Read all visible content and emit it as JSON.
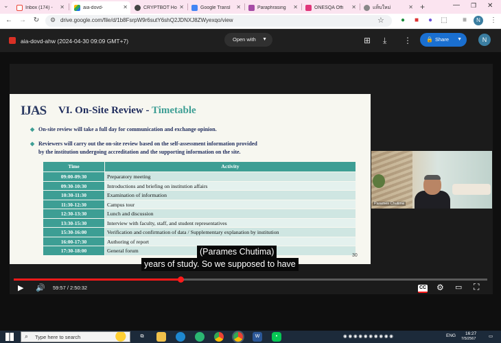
{
  "tabs": [
    {
      "label": "Inbox (174) -",
      "favicon": "gmail-icon",
      "color": "#ea4335"
    },
    {
      "label": "aia-dovd-",
      "favicon": "drive-icon",
      "color": "#1a73e8",
      "active": true
    },
    {
      "label": "CRYPTBOT Ho",
      "favicon": "chatgpt-icon",
      "color": "#444444"
    },
    {
      "label": "Google Transl",
      "favicon": "translate-icon",
      "color": "#4285f4"
    },
    {
      "label": "Paraphrasing",
      "favicon": "quillbot-icon",
      "color": "#a64ca6"
    },
    {
      "label": "ONESQA Offi",
      "favicon": "onesqa-icon",
      "color": "#e0357a"
    },
    {
      "label": "แท็บใหม่",
      "favicon": "chrome-icon",
      "color": "#666666"
    }
  ],
  "new_tab_label": "+",
  "address": {
    "url": "drive.google.com/file/d/1b8FsrpW9r6sutY6shQ2JDNXJ8ZWyexqo/view"
  },
  "profile_initial": "N",
  "drive": {
    "file_title": "aia-dovd-ahw (2024-04-30 09:09 GMT+7)",
    "open_with": "Open with",
    "share": "Share"
  },
  "slide": {
    "logo": "IJAS",
    "title_main": "VI. On-Site Review - ",
    "title_accent": "Timetable",
    "bullets": [
      "On-site review will take a full day for communication and exchange opinion.",
      "Reviewers will carry out the on-site review based on the self-assessment information provided",
      "by the institution undergoing accreditation and the supporting information on the site."
    ],
    "table_header": {
      "time": "Time",
      "activity": "Activity"
    },
    "rows": [
      {
        "time": "09:00-09:30",
        "activity": "Preparatory meeting"
      },
      {
        "time": "09:30-10:30",
        "activity": "Introductions and briefing on institution affairs"
      },
      {
        "time": "10:30-11:30",
        "activity": "Examination of information"
      },
      {
        "time": "11:30-12:30",
        "activity": "Campus tour"
      },
      {
        "time": "12:30-13:30",
        "activity": "Lunch and discussion"
      },
      {
        "time": "13:30-15:30",
        "activity": "Interview with faculty, staff, and student representatives"
      },
      {
        "time": "15:30-16:00",
        "activity": "Verification and confirmation of data / Supplementary explanation by institution"
      },
      {
        "time": "16:00-17:30",
        "activity": "Authoring of report"
      },
      {
        "time": "17:30-18:00",
        "activity": "General forum"
      }
    ],
    "page_number": "30"
  },
  "camera_name": "Parames Chutima",
  "captions": [
    "(Parames Chutima)",
    "years of study. So we supposed to have"
  ],
  "player": {
    "current_time": "59:57",
    "duration": "2:50:32",
    "timecode": "59:57 / 2:50:32",
    "progress": 0.352,
    "buffered": 0.36,
    "cc_label": "CC"
  },
  "taskbar": {
    "search_placeholder": "Type here to search",
    "lang": "ENG",
    "time": "16:27",
    "date": "7/5/2567"
  },
  "colors": {
    "accent": "#1a73e8",
    "teal": "#3d9e94",
    "progress": "#ff1a1a"
  }
}
